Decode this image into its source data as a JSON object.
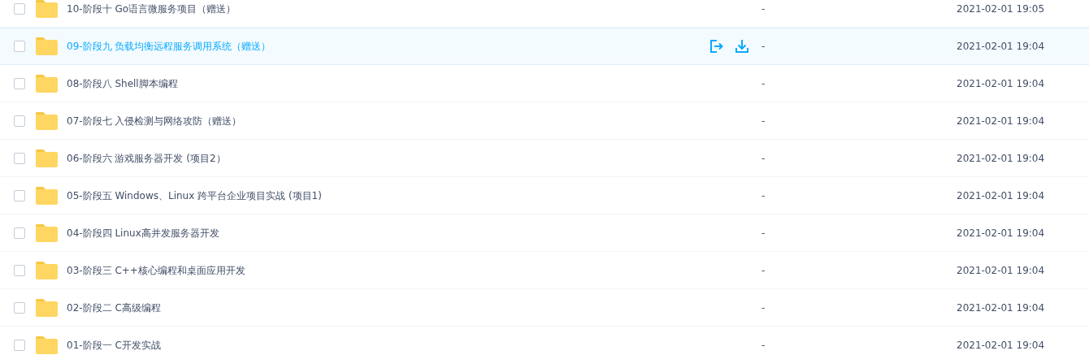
{
  "files": [
    {
      "name": "10-阶段十 Go语言微服务项目（赠送）",
      "size": "-",
      "modified": "2021-02-01 19:05",
      "checked": false,
      "highlighted": false
    },
    {
      "name": "09-阶段九 负载均衡远程服务调用系统（赠送）",
      "size": "-",
      "modified": "2021-02-01 19:04",
      "checked": false,
      "highlighted": true
    },
    {
      "name": "08-阶段八 Shell脚本编程",
      "size": "-",
      "modified": "2021-02-01 19:04",
      "checked": false,
      "highlighted": false
    },
    {
      "name": "07-阶段七 入侵检测与网络攻防（赠送）",
      "size": "-",
      "modified": "2021-02-01 19:04",
      "checked": false,
      "highlighted": false
    },
    {
      "name": "06-阶段六 游戏服务器开发 (项目2）",
      "size": "-",
      "modified": "2021-02-01 19:04",
      "checked": false,
      "highlighted": false
    },
    {
      "name": "05-阶段五 Windows、Linux 跨平台企业项目实战 (项目1)",
      "size": "-",
      "modified": "2021-02-01 19:04",
      "checked": false,
      "highlighted": false
    },
    {
      "name": "04-阶段四 Linux高并发服务器开发",
      "size": "-",
      "modified": "2021-02-01 19:04",
      "checked": false,
      "highlighted": false
    },
    {
      "name": "03-阶段三 C++核心编程和桌面应用开发",
      "size": "-",
      "modified": "2021-02-01 19:04",
      "checked": false,
      "highlighted": false
    },
    {
      "name": "02-阶段二 C高级编程",
      "size": "-",
      "modified": "2021-02-01 19:04",
      "checked": false,
      "highlighted": false
    },
    {
      "name": "01-阶段一 C开发实战",
      "size": "-",
      "modified": "2021-02-01 19:04",
      "checked": false,
      "highlighted": false
    }
  ]
}
